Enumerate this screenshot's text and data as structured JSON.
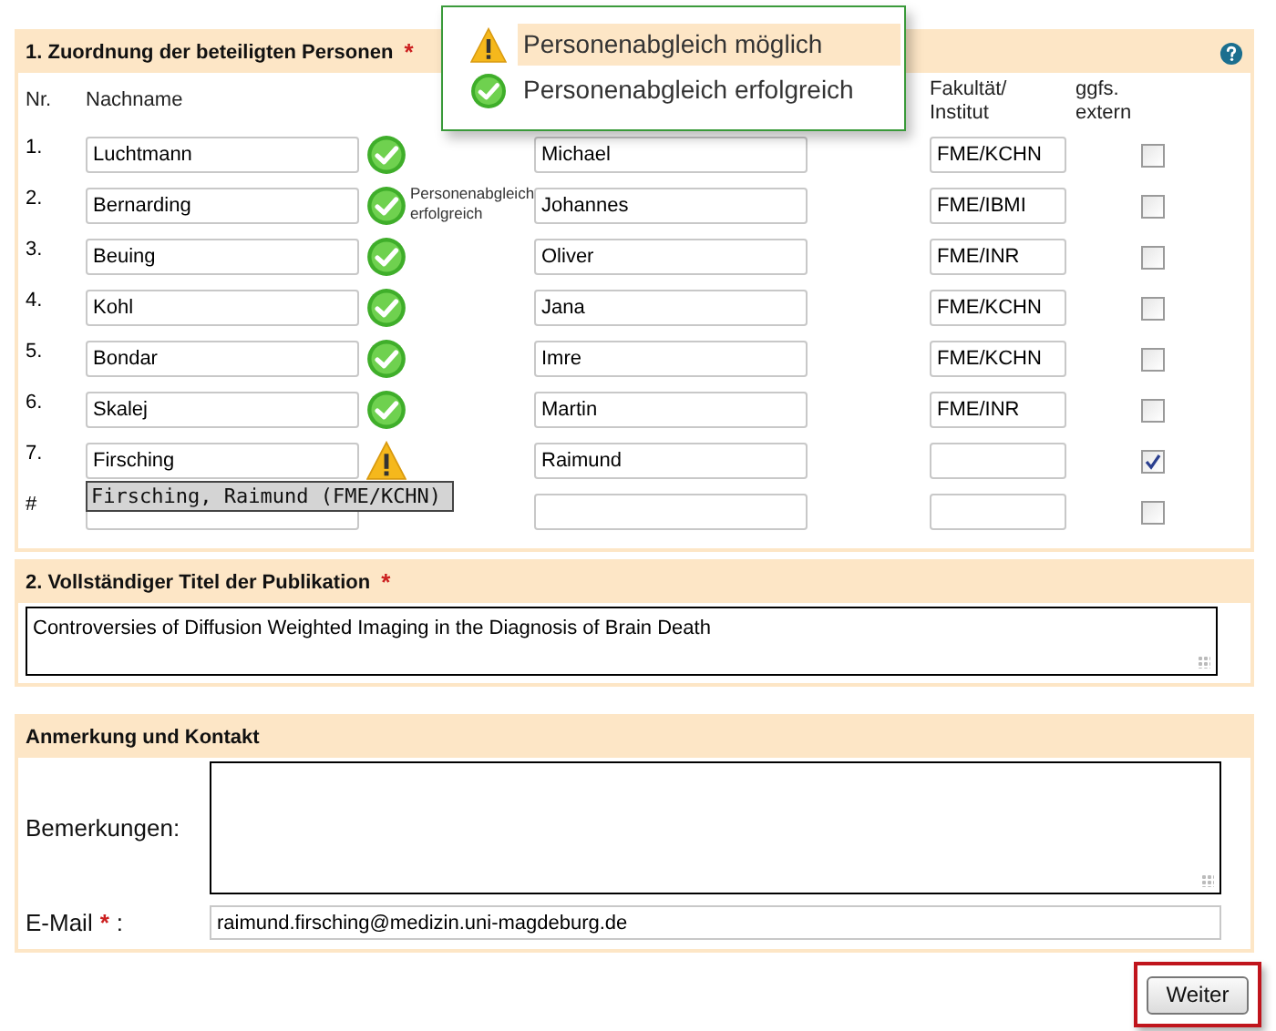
{
  "legend": [
    {
      "kind": "warning",
      "label": "Personenabgleich möglich",
      "selected": true
    },
    {
      "kind": "ok",
      "label": "Personenabgleich erfolgreich",
      "selected": false
    }
  ],
  "persons": {
    "title": "1. Zuordnung der beteiligten Personen",
    "required": "*",
    "columns": [
      "Nr.",
      "Nachname",
      "Fakultät/ Institut",
      "ggfs. extern"
    ],
    "rows": [
      {
        "nr": "1.",
        "nachname": "Luchtmann",
        "kind": "ok",
        "vorname": "Michael",
        "fakultaet": "FME/KCHN",
        "extern": false
      },
      {
        "nr": "2.",
        "nachname": "Bernarding",
        "kind": "ok",
        "vorname": "Johannes",
        "fakultaet": "FME/IBMI",
        "extern": false
      },
      {
        "nr": "3.",
        "nachname": "Beuing",
        "kind": "ok",
        "vorname": "Oliver",
        "fakultaet": "FME/INR",
        "extern": false
      },
      {
        "nr": "4.",
        "nachname": "Kohl",
        "kind": "ok",
        "vorname": "Jana",
        "fakultaet": "FME/KCHN",
        "extern": false
      },
      {
        "nr": "5.",
        "nachname": "Bondar",
        "kind": "ok",
        "vorname": "Imre",
        "fakultaet": "FME/KCHN",
        "extern": false
      },
      {
        "nr": "6.",
        "nachname": "Skalej",
        "kind": "ok",
        "vorname": "Martin",
        "fakultaet": "FME/INR",
        "extern": false
      },
      {
        "nr": "7.",
        "nachname": "Firsching",
        "kind": "warning",
        "vorname": "Raimund",
        "extern": true,
        "suggestion": "Firsching, Raimund (FME/KCHN)"
      },
      {
        "nr": "#",
        "extern": false
      }
    ],
    "tooltip": "Personenabgleich erfolgreich"
  },
  "title_section": {
    "title": "2. Vollständiger Titel der Publikation",
    "required": "*",
    "value": "Controversies of Diffusion Weighted Imaging in the Diagnosis of Brain Death"
  },
  "contact": {
    "title": "Anmerkung und Kontakt",
    "remarks_label": "Bemerkungen:",
    "email_label": "E-Mail",
    "email_required": "*",
    "email_colon": ":",
    "email": "raimund.firsching@medizin.uni-magdeburg.de"
  },
  "next_button": "Weiter"
}
